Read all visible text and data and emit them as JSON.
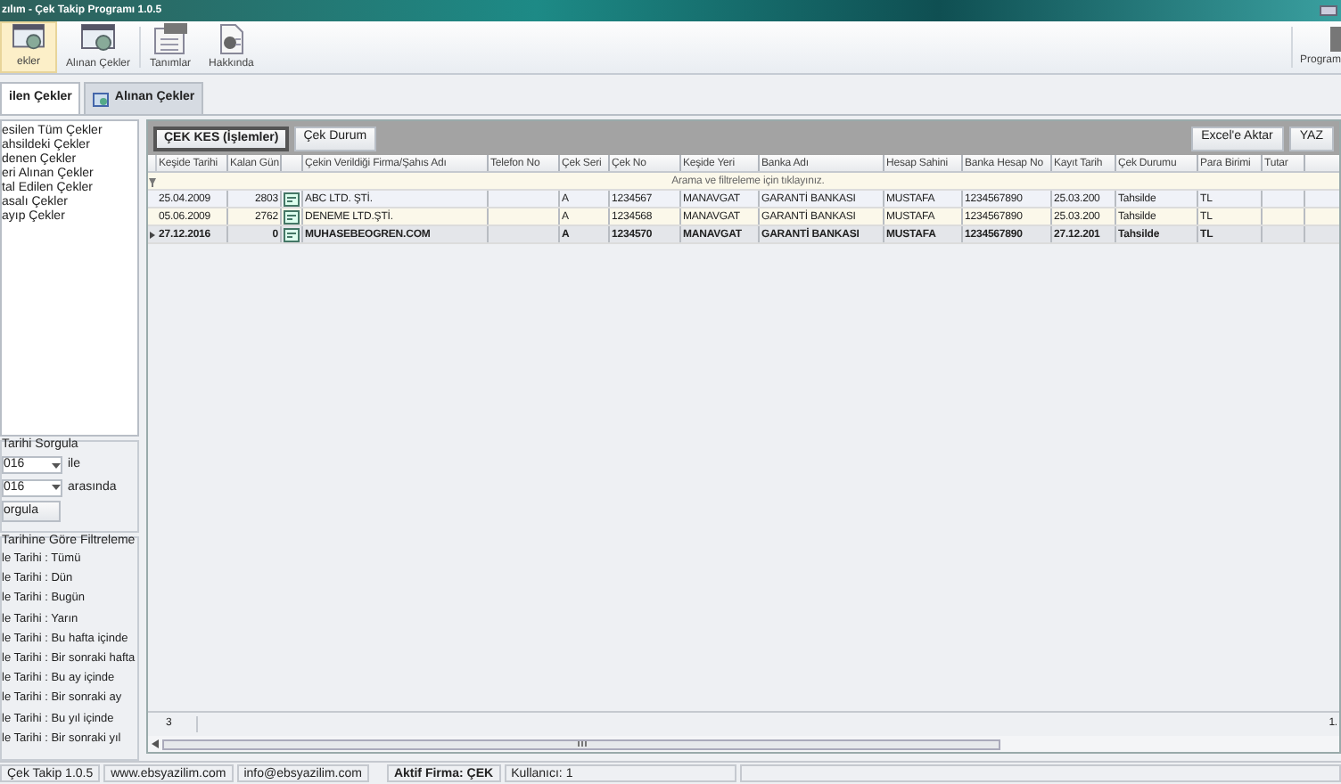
{
  "window": {
    "title": "zılım - Çek Takip Programı 1.0.5"
  },
  "ribbon": {
    "items": [
      {
        "label": "ekler",
        "kind": "cheque",
        "selected": true
      },
      {
        "label": "Alınan Çekler",
        "kind": "cheque",
        "selected": false
      },
      {
        "label": "Tanımlar",
        "kind": "list",
        "selected": false
      },
      {
        "label": "Hakkında",
        "kind": "info",
        "selected": false
      }
    ],
    "right_item": {
      "label": "Program"
    }
  },
  "tabs": [
    {
      "label": "ilen Çekler",
      "selected": true
    },
    {
      "label": "Alınan Çekler",
      "selected": false
    }
  ],
  "sidebar": {
    "items": [
      {
        "label": "esilen Tüm Çekler"
      },
      {
        "label": "ahsildeki Çekler"
      },
      {
        "label": "denen Çekler"
      },
      {
        "label": "eri Alınan Çekler"
      },
      {
        "label": "tal Edilen Çekler"
      },
      {
        "label": "asalı Çekler"
      },
      {
        "label": "ayıp Çekler"
      }
    ],
    "date_query": {
      "title": "Tarihi Sorgula",
      "from": "016",
      "from_suffix": "ile",
      "to": "016",
      "to_suffix": "arasında",
      "button": "orgula"
    },
    "filter": {
      "title": "Tarihine Göre Filtreleme",
      "items": [
        "le Tarihi : Tümü",
        "le Tarihi : Dün",
        "le Tarihi : Bugün",
        "le Tarihi : Yarın",
        "le Tarihi : Bu hafta içinde",
        "le Tarihi : Bir sonraki hafta",
        "le Tarihi : Bu ay içinde",
        "le Tarihi : Bir sonraki ay",
        "le Tarihi : Bu yıl içinde",
        "le Tarihi : Bir sonraki yıl"
      ]
    }
  },
  "toolbar": {
    "left_buttons": [
      {
        "label": "ÇEK KES (İşlemler)",
        "selected": true
      },
      {
        "label": "Çek Durum",
        "selected": false
      }
    ],
    "right_buttons": [
      "Excel'e Aktar",
      "YAZ"
    ]
  },
  "table": {
    "columns": [
      "Keşide Tarihi",
      "Kalan Gün",
      "",
      "Çekin Verildiği Firma/Şahıs Adı",
      "Telefon No",
      "Çek Seri",
      "Çek No",
      "Keşide Yeri",
      "Banka Adı",
      "Hesap Sahini",
      "Banka Hesap No",
      "Kayıt Tarih",
      "Çek Durumu",
      "Para Birimi",
      "Tutar"
    ],
    "filter_hint": "Arama ve filtreleme için tıklayınız.",
    "rows": [
      {
        "selected": false,
        "cells": [
          "25.04.2009",
          "2803",
          "",
          "ABC LTD. ŞTİ.",
          "",
          "A",
          "1234567",
          "MANAVGAT",
          "GARANTİ BANKASI",
          "MUSTAFA",
          "1234567890",
          "25.03.200",
          "Tahsilde",
          "TL",
          ""
        ]
      },
      {
        "selected": false,
        "cells": [
          "05.06.2009",
          "2762",
          "",
          "DENEME LTD.ŞTİ.",
          "",
          "A",
          "1234568",
          "MANAVGAT",
          "GARANTİ BANKASI",
          "MUSTAFA",
          "1234567890",
          "25.03.200",
          "Tahsilde",
          "TL",
          ""
        ]
      },
      {
        "selected": true,
        "cells": [
          "27.12.2016",
          "0",
          "",
          "MUHASEBEOGREN.COM",
          "",
          "A",
          "1234570",
          "MANAVGAT",
          "GARANTİ BANKASI",
          "MUSTAFA",
          "1234567890",
          "27.12.201",
          "Tahsilde",
          "TL",
          ""
        ]
      }
    ],
    "footer_count": "3",
    "footer_total": "1."
  },
  "status_bar": [
    {
      "text": "Çek Takip 1.0.5",
      "bold": false
    },
    {
      "text": "www.ebsyazilim.com",
      "bold": false
    },
    {
      "text": "info@ebsyazilim.com",
      "bold": false
    },
    {
      "text": "Aktif Firma: ÇEK",
      "bold": true
    },
    {
      "text": "Kullanıcı: 1",
      "bold": false
    }
  ]
}
